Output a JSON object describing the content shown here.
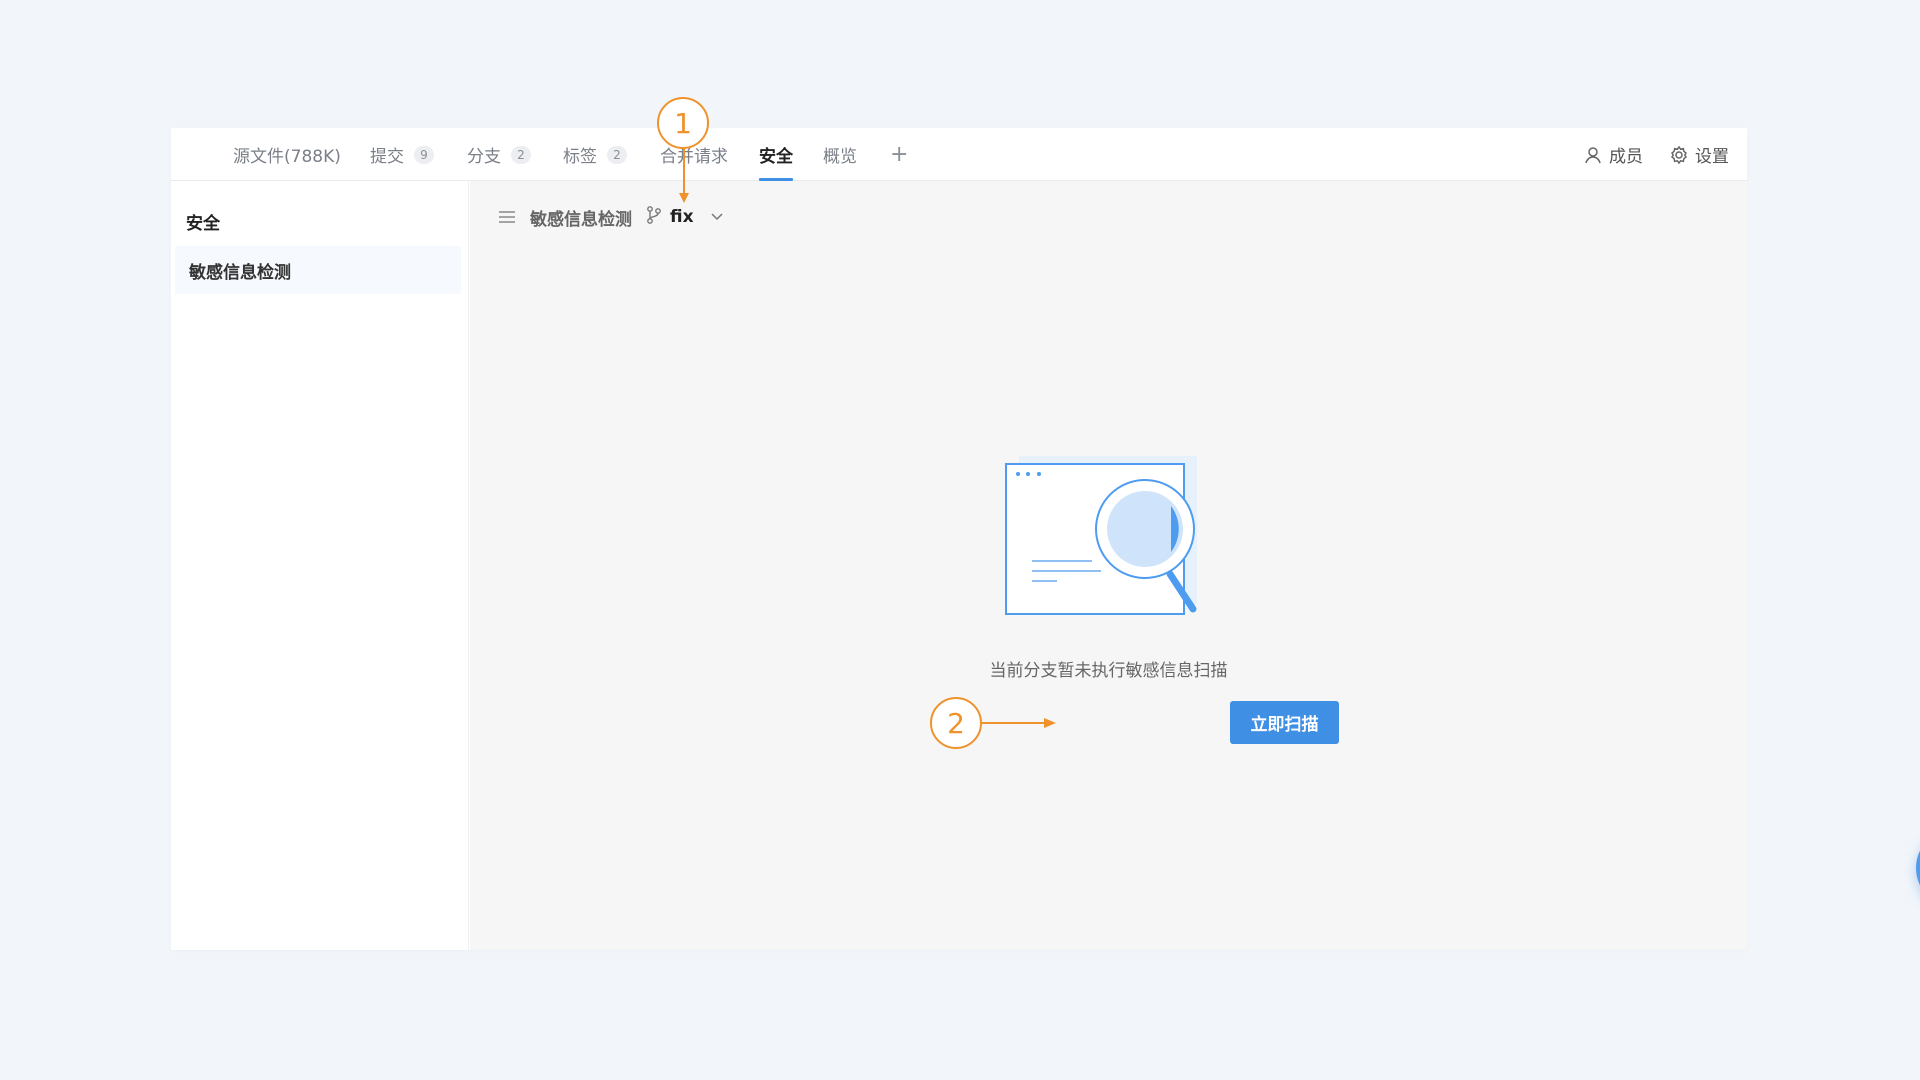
{
  "tabs": [
    {
      "label": "源文件(788K)",
      "badge": null,
      "active": false
    },
    {
      "label": "提交",
      "badge": "9",
      "active": false
    },
    {
      "label": "分支",
      "badge": "2",
      "active": false
    },
    {
      "label": "标签",
      "badge": "2",
      "active": false
    },
    {
      "label": "合并请求",
      "badge": null,
      "active": false
    },
    {
      "label": "安全",
      "badge": null,
      "active": true
    },
    {
      "label": "概览",
      "badge": null,
      "active": false
    }
  ],
  "add_tab": "+",
  "header_actions": {
    "members_label": "成员",
    "settings_label": "设置"
  },
  "sidebar": {
    "title": "安全",
    "items": [
      {
        "label": "敏感信息检测",
        "selected": true
      }
    ]
  },
  "main": {
    "breadcrumb_label": "敏感信息检测",
    "branch": "fix",
    "empty_message": "当前分支暂未执行敏感信息扫描",
    "scan_button_label": "立即扫描"
  },
  "callouts": [
    "1",
    "2"
  ],
  "colors": {
    "accent": "#3f8fe4",
    "callout": "#f0922b",
    "background": "#f2f6fa"
  }
}
